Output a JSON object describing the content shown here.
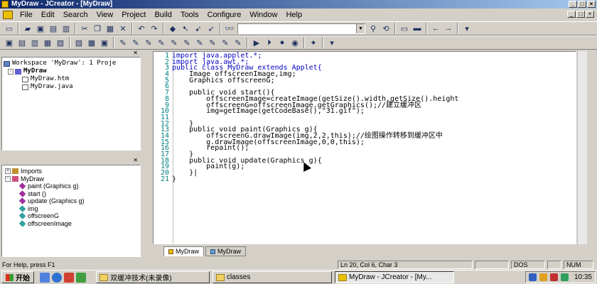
{
  "window": {
    "title": "MyDraw - JCreator - [MyDraw]"
  },
  "menu": [
    "File",
    "Edit",
    "Search",
    "View",
    "Project",
    "Build",
    "Tools",
    "Configure",
    "Window",
    "Help"
  ],
  "find_box": {
    "value": ""
  },
  "workspace": {
    "root": "Workspace 'MyDraw': 1 Proje",
    "project": "MyDraw",
    "files": [
      "MyDraw.htm",
      "MyDraw.java"
    ]
  },
  "outline": {
    "items": [
      {
        "label": "Imports",
        "icon": "imports-icon"
      },
      {
        "label": "MyDraw",
        "icon": "class-icon"
      },
      {
        "label": "paint (Graphics g)",
        "icon": "method-icon"
      },
      {
        "label": "start ()",
        "icon": "method-icon"
      },
      {
        "label": "update (Graphics g)",
        "icon": "method-icon"
      },
      {
        "label": "img",
        "icon": "field-icon"
      },
      {
        "label": "offscreenG",
        "icon": "field-icon"
      },
      {
        "label": "offscreenImage",
        "icon": "field-icon"
      }
    ]
  },
  "editor": {
    "lines": [
      {
        "n": "1",
        "text": "import java.applet.*;"
      },
      {
        "n": "2",
        "text": "import java.awt.*;"
      },
      {
        "n": "3",
        "text": "public class MyDraw extends Applet{"
      },
      {
        "n": "4",
        "text": "    Image offscreenImage,img;"
      },
      {
        "n": "5",
        "text": "    Graphics offscreenG;"
      },
      {
        "n": "6",
        "text": ""
      },
      {
        "n": "7",
        "text": "    public void start(){"
      },
      {
        "n": "8",
        "text": "        offscreenImage=createImage(getSize().width,getSize().height"
      },
      {
        "n": "9",
        "text": "        offscreenG=offscreenImage.getGraphics();//建立缓冲区"
      },
      {
        "n": "10",
        "text": "        img=getImage(getCodeBase(),\"31.gif\");"
      },
      {
        "n": "11",
        "text": ""
      },
      {
        "n": "12",
        "text": "    }"
      },
      {
        "n": "13",
        "text": "    public void paint(Graphics g){"
      },
      {
        "n": "14",
        "text": "        offscreenG.drawImage(img,2,2,this);//绘图操作转移到缓冲区中"
      },
      {
        "n": "15",
        "text": "        g.drawImage(offscreenImage,0,0,this);"
      },
      {
        "n": "16",
        "text": "        repaint();"
      },
      {
        "n": "17",
        "text": "    }"
      },
      {
        "n": "18",
        "text": "    public void update(Graphics g){"
      },
      {
        "n": "19",
        "text": "        paint(g);"
      },
      {
        "n": "20",
        "text": "    }|"
      },
      {
        "n": "21",
        "text": "}"
      }
    ]
  },
  "doc_tabs": [
    "MyDraw",
    "MyDraw"
  ],
  "status": {
    "help": "For Help, press F1",
    "position": "Ln 20, Col 6, Char 3",
    "mode": "DOS",
    "num": "NUM"
  },
  "taskbar": {
    "start": "开始",
    "tasks": [
      {
        "label": "双缓冲技术(未录像)",
        "active": false
      },
      {
        "label": "classes",
        "active": false
      },
      {
        "label": "MyDraw - JCreator - [My...",
        "active": true
      }
    ],
    "clock": "10:35"
  }
}
